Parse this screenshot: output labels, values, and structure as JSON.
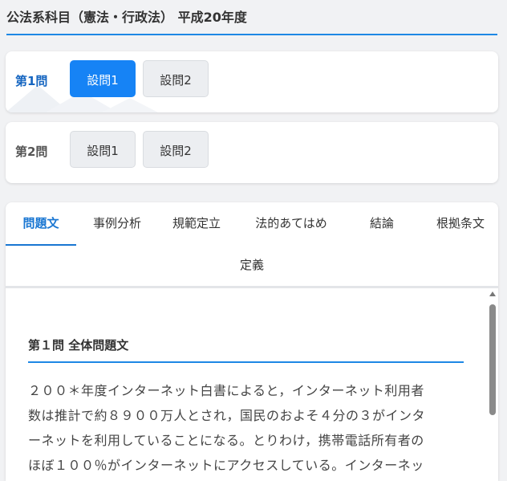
{
  "header": {
    "title": "公法系科目（憲法・行政法） 平成20年度"
  },
  "questions": [
    {
      "label": "第1問",
      "subs": [
        {
          "label": "設問1",
          "active": true
        },
        {
          "label": "設問2",
          "active": false
        }
      ]
    },
    {
      "label": "第2問",
      "subs": [
        {
          "label": "設問1",
          "active": false
        },
        {
          "label": "設問2",
          "active": false
        }
      ]
    }
  ],
  "tabs": [
    {
      "label": "問題文",
      "active": true
    },
    {
      "label": "事例分析"
    },
    {
      "label": "規範定立"
    },
    {
      "label": "法的あてはめ"
    },
    {
      "label": "結論"
    },
    {
      "label": "根拠条文"
    },
    {
      "label": "定義"
    }
  ],
  "content": {
    "section_title": "第１問 全体問題文",
    "body_lines": [
      "２００＊年度インターネット白書によると，インターネット利用者",
      "数は推計で約８９００万人とされ，国民のおよそ４分の３がインタ",
      "ーネットを利用していることになる。とりわけ，携帯電話所有者の",
      "ほぼ１００％がインターネットにアクセスしている。インターネッ"
    ]
  },
  "colors": {
    "accent": "#1683f5",
    "tab_active": "#1976d2"
  }
}
